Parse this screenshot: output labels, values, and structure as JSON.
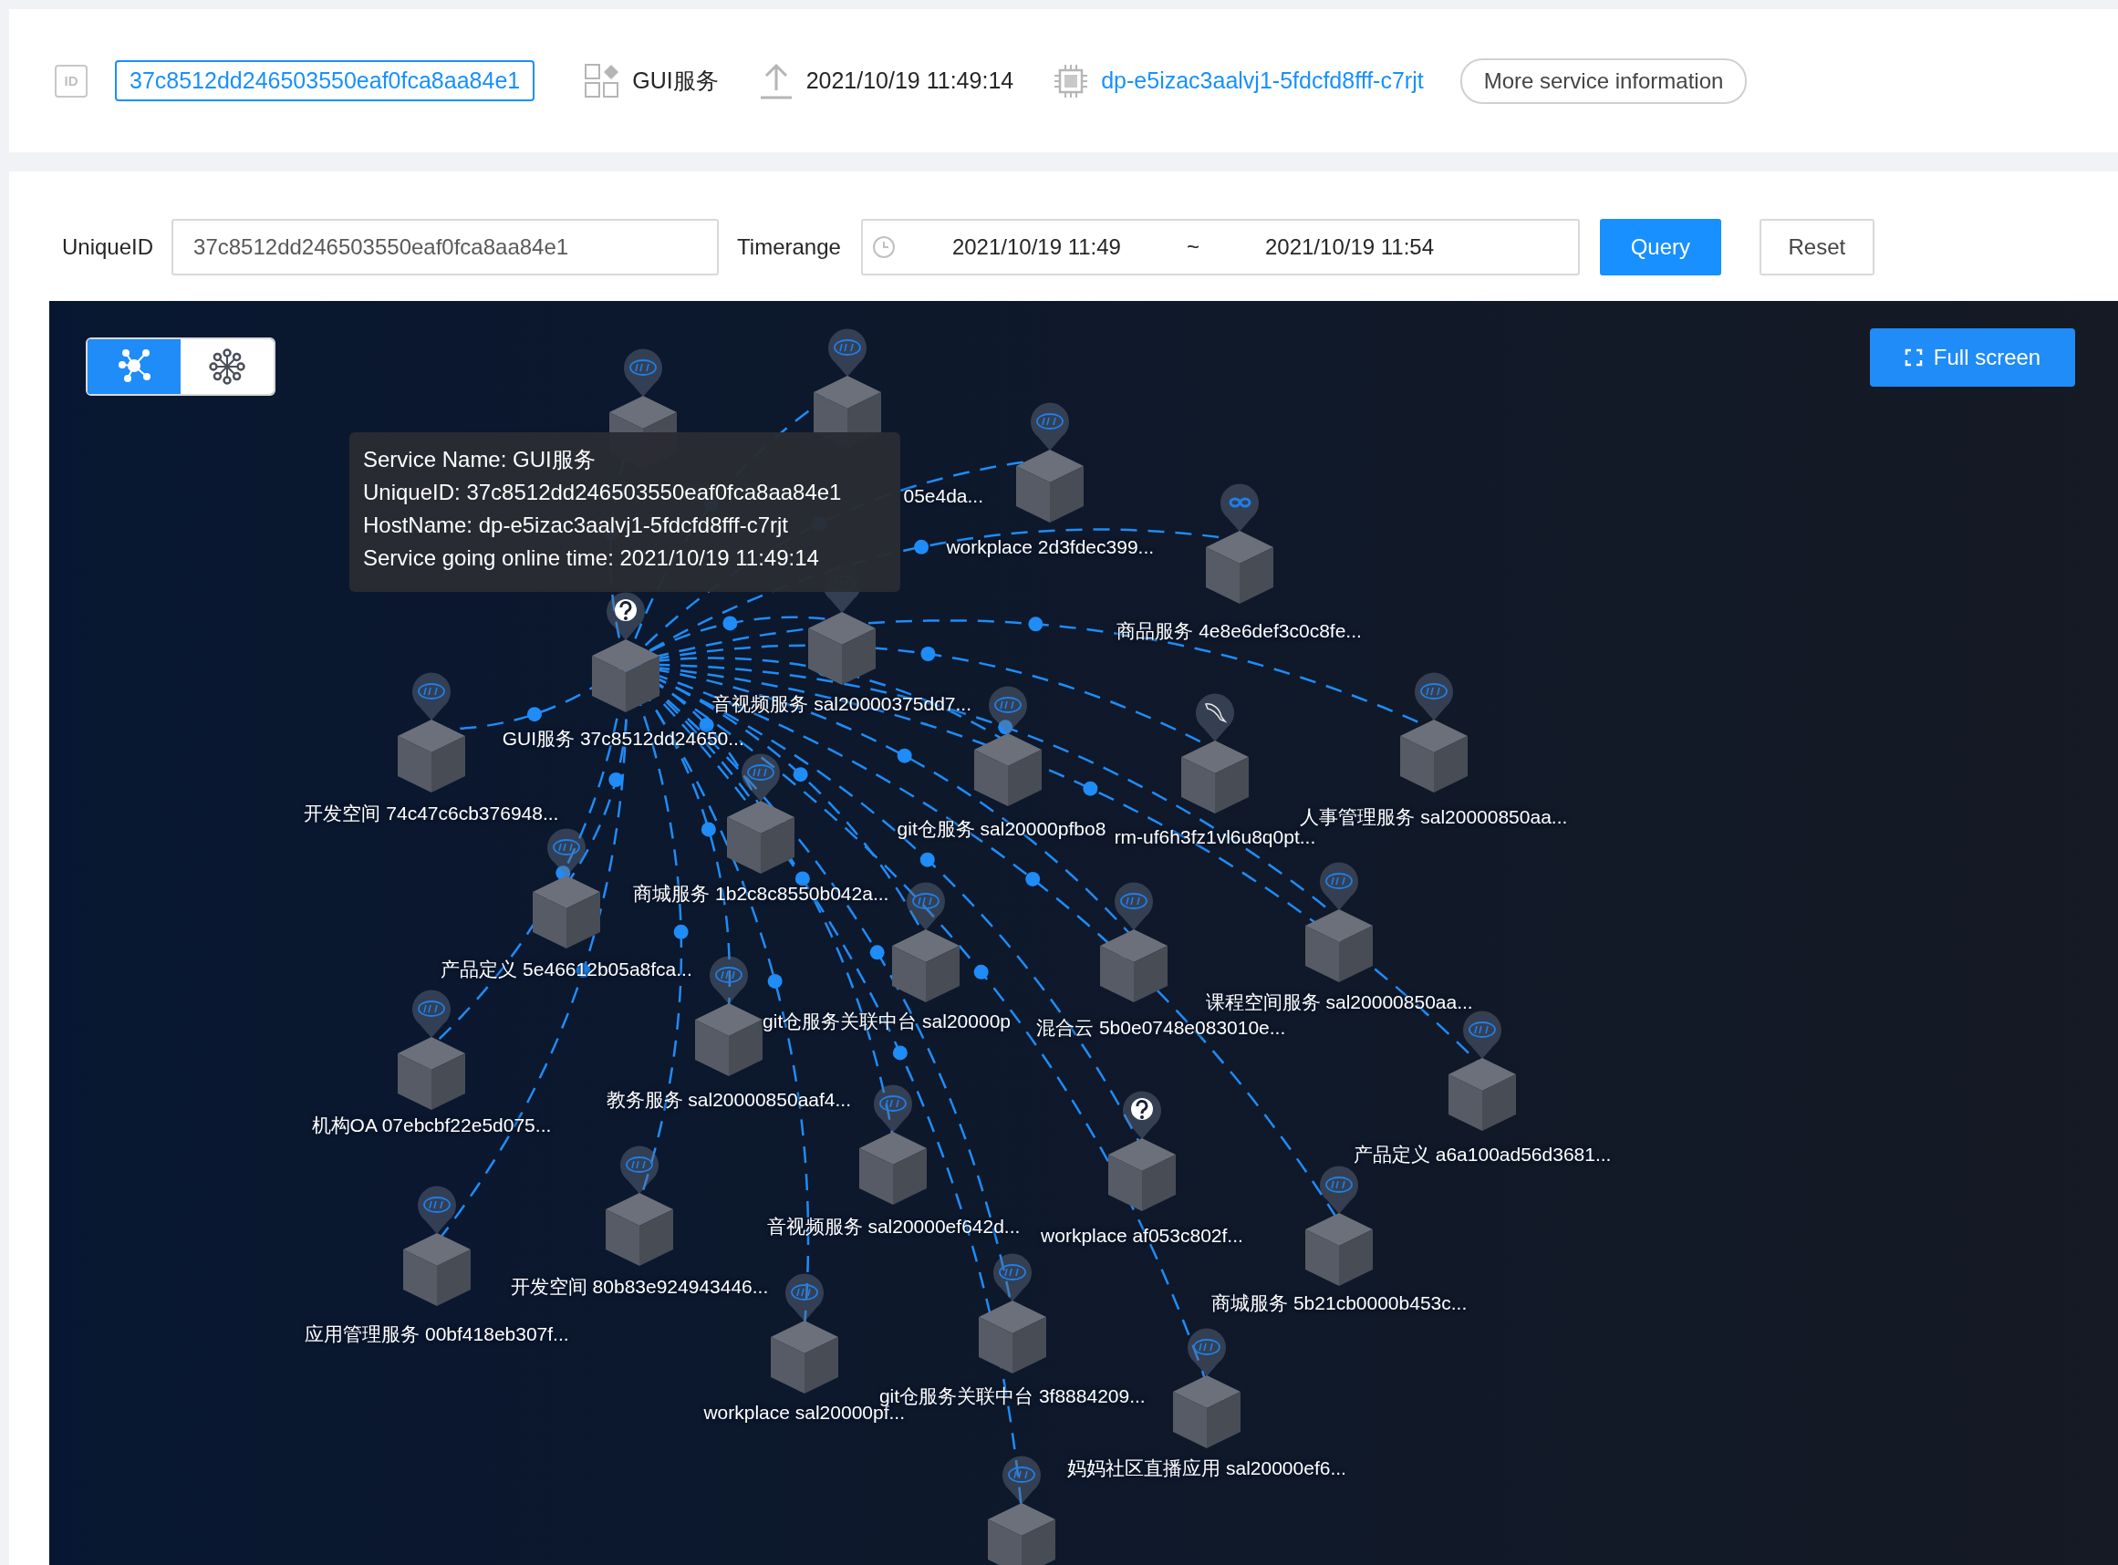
{
  "header": {
    "id_badge": "ID",
    "unique_id": "37c8512dd246503550eaf0fca8aa84e1",
    "service_name": "GUI服务",
    "online_time": "2021/10/19 11:49:14",
    "host_name": "dp-e5izac3aalvj1-5fdcfd8fff-c7rjt",
    "more_button": "More service information"
  },
  "filters": {
    "unique_id_label": "UniqueID",
    "unique_id_value": "37c8512dd246503550eaf0fca8aa84e1",
    "timerange_label": "Timerange",
    "start": "2021/10/19 11:49",
    "separator": "~",
    "end": "2021/10/19 11:54",
    "query_button": "Query",
    "reset_button": "Reset"
  },
  "graph": {
    "view_modes": [
      {
        "kind": "network",
        "selected": true
      },
      {
        "kind": "radial",
        "selected": false
      }
    ],
    "fullscreen_button": "Full screen",
    "nodes": [
      {
        "label": "GUI服务 37c8512dd24650...",
        "kind": "unknown"
      },
      {
        "label": "05e4da...",
        "kind": "php"
      },
      {
        "kind": "php"
      },
      {
        "label": "workplace 2d3fdec399...",
        "kind": "php"
      },
      {
        "label": "商品服务 4e8e6def3c0c8fe...",
        "kind": "go"
      },
      {
        "label": "音视频服务 sal20000375dd7...",
        "kind": "php"
      },
      {
        "label": "开发空间 74c47c6cb376948...",
        "kind": "php"
      },
      {
        "label": "git仓服务 sal20000pfbo8",
        "kind": "php"
      },
      {
        "label": "rm-uf6h3fz1vl6u8q0pt...",
        "kind": "mysql"
      },
      {
        "label": "人事管理服务 sal20000850aa...",
        "kind": "php"
      },
      {
        "label": "商城服务 1b2c8c8550b042a...",
        "kind": "php"
      },
      {
        "label": "产品定义 5e46612b05a8fca...",
        "kind": "php"
      },
      {
        "label": "git仓服务关联中台 sal20000p",
        "kind": "php"
      },
      {
        "label": "混合云 5b0e0748e083010e...",
        "kind": "php"
      },
      {
        "label": "课程空间服务 sal20000850aa...",
        "kind": "php"
      },
      {
        "label": "机构OA 07ebcbf22e5d075...",
        "kind": "php"
      },
      {
        "label": "教务服务 sal20000850aaf4...",
        "kind": "php"
      },
      {
        "label": "产品定义 a6a100ad56d3681...",
        "kind": "php"
      },
      {
        "label": "音视频服务 sal20000ef642d...",
        "kind": "php"
      },
      {
        "label": "workplace af053c802f...",
        "kind": "unknown"
      },
      {
        "label": "商城服务 5b21cb0000b453c...",
        "kind": "php"
      },
      {
        "label": "开发空间 80b83e924943446...",
        "kind": "php"
      },
      {
        "label": "应用管理服务 00bf418eb307f...",
        "kind": "php"
      },
      {
        "label": "workplace sal20000pf...",
        "kind": "php"
      },
      {
        "label": "git仓服务关联中台 3f8884209...",
        "kind": "php"
      },
      {
        "label": "妈妈社区直播应用 sal20000ef6...",
        "kind": "php"
      },
      {
        "kind": "php"
      }
    ],
    "tooltip": {
      "lines": [
        "Service Name: GUI服务",
        "UniqueID: 37c8512dd246503550eaf0fca8aa84e1",
        "HostName: dp-e5izac3aalvj1-5fdcfd8fff-c7rjt",
        "Service going online time: 2021/10/19 11:49:14"
      ]
    }
  }
}
